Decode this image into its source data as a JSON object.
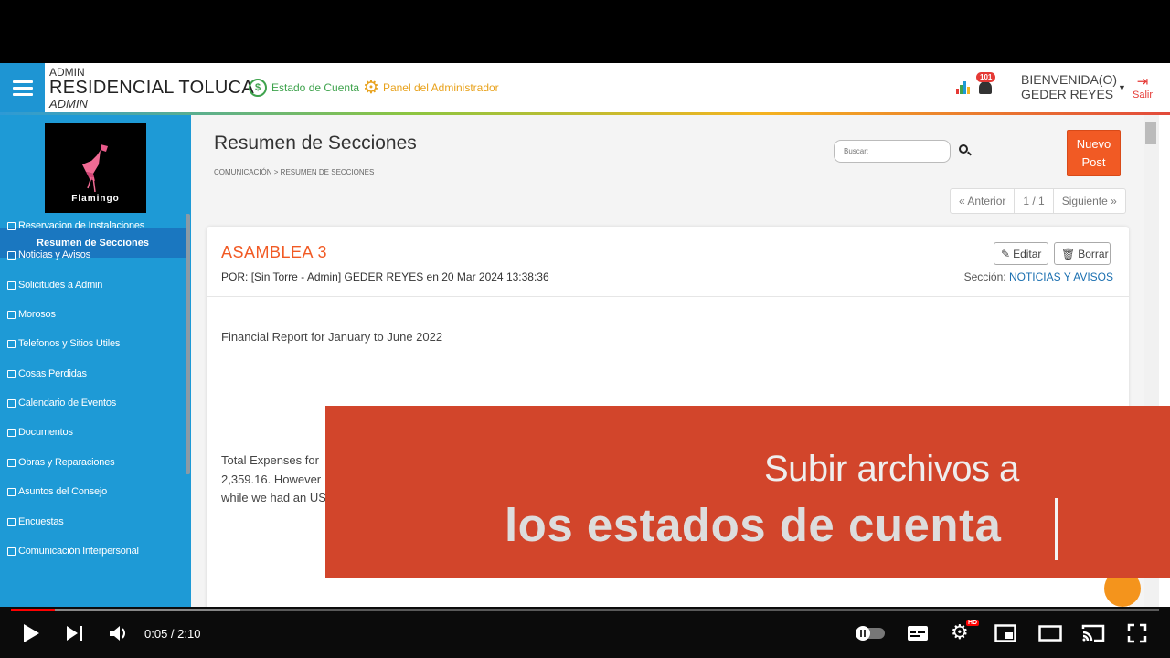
{
  "topbar": {
    "role_small": "ADMIN",
    "site_name": "RESIDENCIAL TOLUCA",
    "role_italic": "ADMIN",
    "estado_link": "Estado de Cuenta",
    "panel_link": "Panel del Administrador",
    "notif_count": "101",
    "welcome_line1": "BIENVENIDA(O)",
    "welcome_line2": "GEDER REYES",
    "salir": "Salir"
  },
  "sidebar": {
    "logo_text": "Flamingo",
    "active_item": "Resumen de Secciones",
    "items": [
      {
        "label": "Reservacion de Instalaciones",
        "icon": "calendar-icon"
      },
      {
        "label": "Noticias y Avisos",
        "icon": "square-icon"
      },
      {
        "label": "Solicitudes a Admin",
        "icon": "stack-icon"
      },
      {
        "label": "Morosos",
        "icon": "file-icon"
      },
      {
        "label": "Telefonos y Sitios Utiles",
        "icon": "square-icon"
      },
      {
        "label": "Cosas Perdidas",
        "icon": "binoculars-icon"
      },
      {
        "label": "Calendario de Eventos",
        "icon": "calendar-icon"
      },
      {
        "label": "Documentos",
        "icon": "square-icon"
      },
      {
        "label": "Obras y Reparaciones",
        "icon": "wrench-icon"
      },
      {
        "label": "Asuntos del Consejo",
        "icon": "users-icon"
      },
      {
        "label": "Encuestas",
        "icon": "check-square-icon"
      },
      {
        "label": "Comunicación Interpersonal",
        "icon": "chat-icon"
      }
    ]
  },
  "main": {
    "title": "Resumen de Secciones",
    "breadcrumb": "COMUNICACIÓN > RESUMEN DE SECCIONES",
    "search_placeholder": "Buscar:",
    "new_post": [
      "Nuevo",
      "Post"
    ],
    "pager": {
      "prev": "« Anterior",
      "page": "1 / 1",
      "next": "Siguiente »"
    }
  },
  "post": {
    "title": "ASAMBLEA 3",
    "author_label": "POR:",
    "author": "[Sin Torre - Admin] GEDER REYES",
    "date": "en 20 Mar 2024 13:38:36",
    "edit": "Editar",
    "delete": "Borrar",
    "section_label": "Sección:",
    "section": "NOTICIAS Y AVISOS",
    "body1": "Financial Report for January to June 2022",
    "body2": [
      "Total Expenses for",
      "2,359.16. However",
      "while we had an US"
    ]
  },
  "overlay": {
    "line1": "Subir archivos a",
    "line2": "los estados de cuenta"
  },
  "player": {
    "current_time": "0:05",
    "duration": "2:10",
    "time_display": "0:05 / 2:10",
    "progress_fraction": 0.038,
    "buffered_fraction": 0.2,
    "hd_badge": "HD"
  },
  "colors": {
    "sidebar": "#1e9ad6",
    "active": "#1a77c0",
    "accent_orange": "#f15a24",
    "overlay": "#d2452b",
    "progress": "#ff0000"
  }
}
